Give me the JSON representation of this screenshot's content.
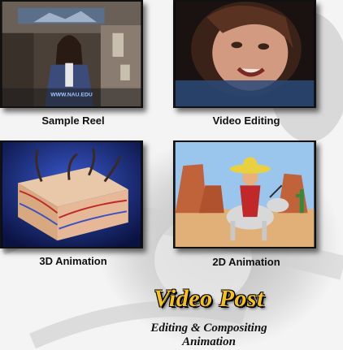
{
  "gallery": [
    {
      "label": "Sample Reel",
      "watermark": "WWW.NAU.EDU"
    },
    {
      "label": "Video Editing"
    },
    {
      "label": "3D Animation"
    },
    {
      "label": "2D Animation"
    }
  ],
  "title": "Video Post",
  "subtitle": {
    "line1": "Editing & Compositing",
    "line2": "Animation"
  },
  "colors": {
    "title": "#f6c21a",
    "background": "#f4f4f4"
  }
}
